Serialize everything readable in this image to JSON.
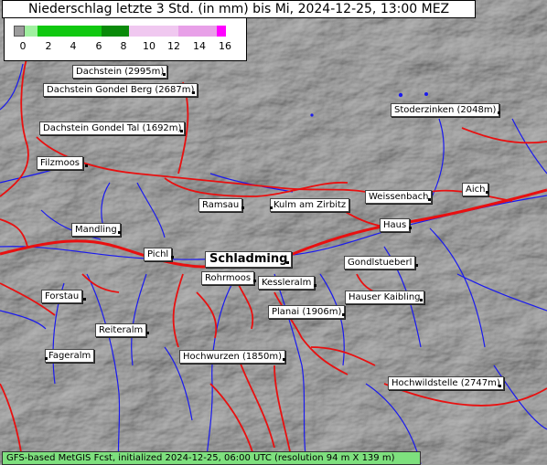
{
  "title": "Niederschlag letzte 3 Std. (in mm) bis Mi, 2024-12-25, 13:00 MEZ",
  "legend": {
    "ticks": [
      "0",
      "2",
      "4",
      "6",
      "8",
      "10",
      "12",
      "14",
      "16"
    ],
    "colors": {
      "gray": "#9c9c9c",
      "lightgreen": "#a0f0a0",
      "green": "#10c810",
      "darkgreen": "#0a8a0a",
      "pink1": "#f0c8f0",
      "pink2": "#e8a0e8",
      "magenta": "#ff00ff"
    }
  },
  "places": [
    {
      "name": "Dachstein (2995m)"
    },
    {
      "name": "Dachstein Gondel Berg (2687m)"
    },
    {
      "name": "Dachstein Gondel Tal (1692m)"
    },
    {
      "name": "Filzmoos"
    },
    {
      "name": "Ramsau"
    },
    {
      "name": "Kulm am Zirbitz"
    },
    {
      "name": "Weissenbach"
    },
    {
      "name": "Aich"
    },
    {
      "name": "Stoderzinken (2048m)"
    },
    {
      "name": "Mandling"
    },
    {
      "name": "Haus"
    },
    {
      "name": "Pichl"
    },
    {
      "name": "Schladming"
    },
    {
      "name": "Gondlstueberl"
    },
    {
      "name": "Rohrmoos"
    },
    {
      "name": "Kessleralm"
    },
    {
      "name": "Forstau"
    },
    {
      "name": "Hauser Kaibling"
    },
    {
      "name": "Planai (1906m)"
    },
    {
      "name": "Reiteralm"
    },
    {
      "name": "Fageralm"
    },
    {
      "name": "Hochwurzen (1850m)"
    },
    {
      "name": "Hochwildstelle (2747m)"
    }
  ],
  "footer": "GFS-based MetGIS Fcst, initialized 2024-12-25, 06:00 UTC  (resolution 94 m X 139 m)"
}
